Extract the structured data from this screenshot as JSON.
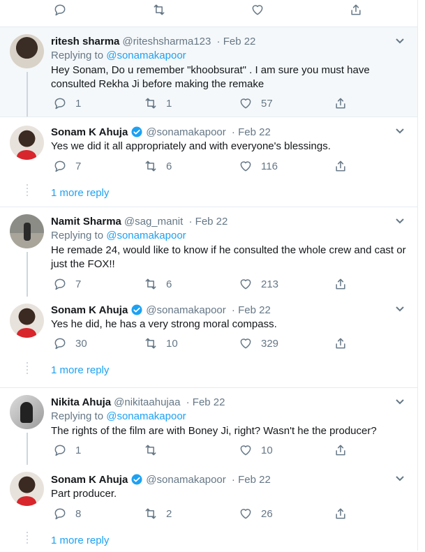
{
  "top_actions": {
    "reply_count": "",
    "retweet_count": "",
    "like_count": ""
  },
  "tweets": [
    {
      "name": "ritesh sharma",
      "handle": "@riteshsharma123",
      "date": "Feb 22",
      "replying_label": "Replying to",
      "replying_to": "@sonamakapoor",
      "text": "Hey Sonam, Do u remember \"khoobsurat\" . I am sure you must have consulted Rekha Ji before making the remake",
      "replies": "1",
      "retweets": "1",
      "likes": "57"
    },
    {
      "name": "Sonam K Ahuja",
      "handle": "@sonamakapoor",
      "date": "Feb 22",
      "verified": true,
      "text": "Yes we did it all appropriately and with everyone's blessings.",
      "replies": "7",
      "retweets": "6",
      "likes": "116",
      "more_replies": "1 more reply"
    },
    {
      "name": "Namit Sharma",
      "handle": "@sag_manit",
      "date": "Feb 22",
      "replying_label": "Replying to",
      "replying_to": "@sonamakapoor",
      "text": "He remade 24, would like to know if he consulted the whole crew and cast or just the FOX!!",
      "replies": "7",
      "retweets": "6",
      "likes": "213"
    },
    {
      "name": "Sonam K Ahuja",
      "handle": "@sonamakapoor",
      "date": "Feb 22",
      "verified": true,
      "text": "Yes he did, he has a very strong moral compass.",
      "replies": "30",
      "retweets": "10",
      "likes": "329",
      "more_replies": "1 more reply"
    },
    {
      "name": "Nikita Ahuja",
      "handle": "@nikitaahujaa",
      "date": "Feb 22",
      "replying_label": "Replying to",
      "replying_to": "@sonamakapoor",
      "text": "The rights of the film are with Boney Ji, right? Wasn't he the producer?",
      "replies": "1",
      "retweets": "",
      "likes": "10"
    },
    {
      "name": "Sonam K Ahuja",
      "handle": "@sonamakapoor",
      "date": "Feb 22",
      "verified": true,
      "text": "Part producer.",
      "replies": "8",
      "retweets": "2",
      "likes": "26",
      "more_replies": "1 more reply"
    }
  ],
  "colors": {
    "link": "#1da1f2",
    "muted": "#657786",
    "highlight": "#f5f8fa",
    "verified": "#1da1f2"
  },
  "icons": [
    "reply-icon",
    "retweet-icon",
    "like-icon",
    "share-icon",
    "chevron-down-icon",
    "verified-badge-icon"
  ]
}
